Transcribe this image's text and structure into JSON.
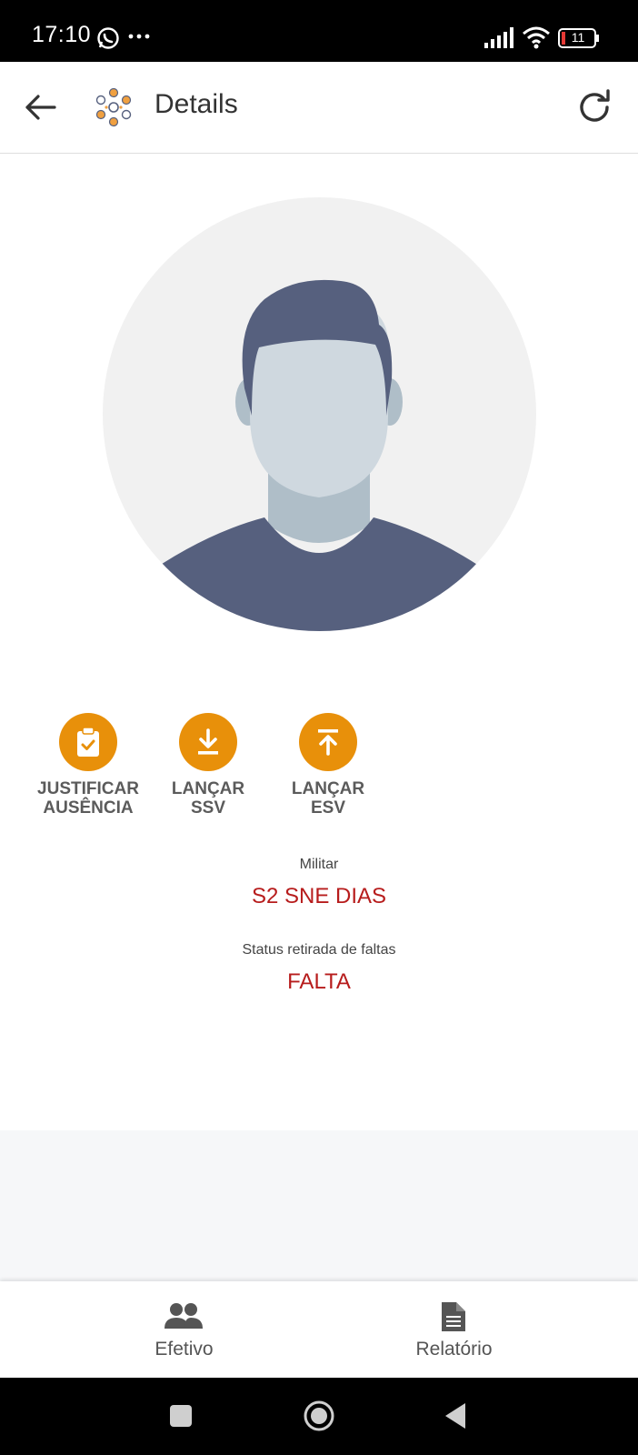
{
  "status_bar": {
    "time": "17:10",
    "battery_level": "11",
    "icons": [
      "whatsapp-icon",
      "more-dots-icon",
      "signal-icon",
      "wifi-icon",
      "battery-icon"
    ]
  },
  "app_bar": {
    "title": "Details",
    "back_icon": "arrow-left-icon",
    "logo_icon": "dots-cluster-logo",
    "refresh_icon": "refresh-icon"
  },
  "actions": [
    {
      "label": "JUSTIFICAR\nAUSÊNCIA",
      "icon": "clipboard-check-icon"
    },
    {
      "label": "LANÇAR\nSSV",
      "icon": "download-icon"
    },
    {
      "label": "LANÇAR\nESV",
      "icon": "upload-icon"
    }
  ],
  "info": {
    "militar_label": "Militar",
    "militar_value": "S2 SNE DIAS",
    "status_label": "Status retirada de faltas",
    "status_value": "FALTA"
  },
  "bottom_nav": {
    "items": [
      {
        "label": "Efetivo",
        "icon": "people-icon"
      },
      {
        "label": "Relatório",
        "icon": "document-icon"
      }
    ]
  },
  "colors": {
    "accent": "#e8900a",
    "value_red": "#b71c1c",
    "avatar_bg": "#f1f1f1",
    "avatar_hair": "#56607e",
    "avatar_skin": "#cfd8df"
  }
}
